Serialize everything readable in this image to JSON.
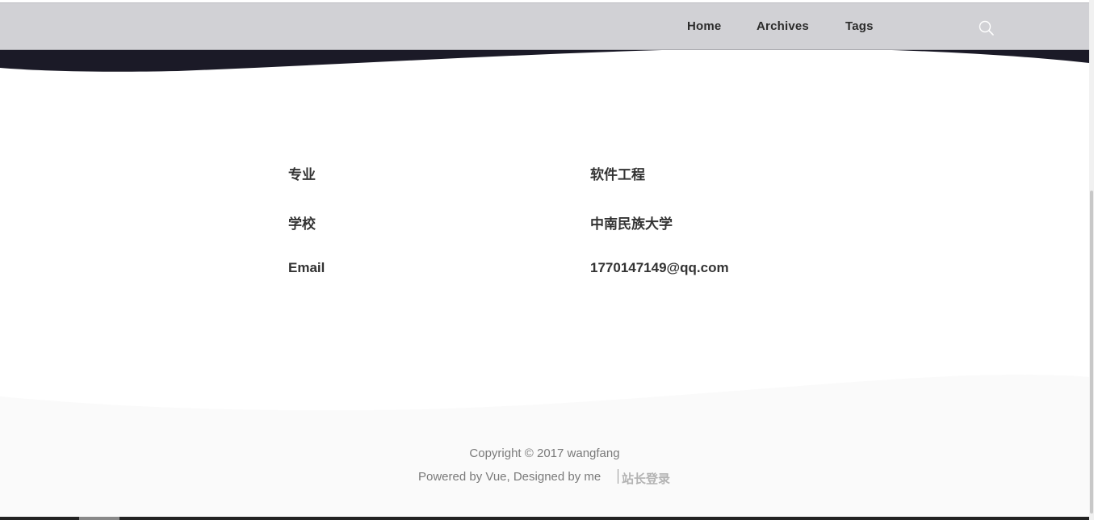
{
  "nav": {
    "home": "Home",
    "archives": "Archives",
    "tags": "Tags",
    "search_icon": "search-icon"
  },
  "info": {
    "rows": [
      {
        "label": "专业",
        "value": "软件工程"
      },
      {
        "label": "学校",
        "value": "中南民族大学"
      },
      {
        "label": "Email",
        "value": "1770147149@qq.com"
      }
    ]
  },
  "footer": {
    "copyright": "Copyright © 2017 wangfang",
    "powered": "Powered by Vue, Designed by me",
    "admin_link": "站长登录"
  },
  "colors": {
    "header_bg": "#d1d1d5",
    "dark_band": "#1b1a27",
    "footer_bg": "#fafafa",
    "text": "#333333"
  }
}
